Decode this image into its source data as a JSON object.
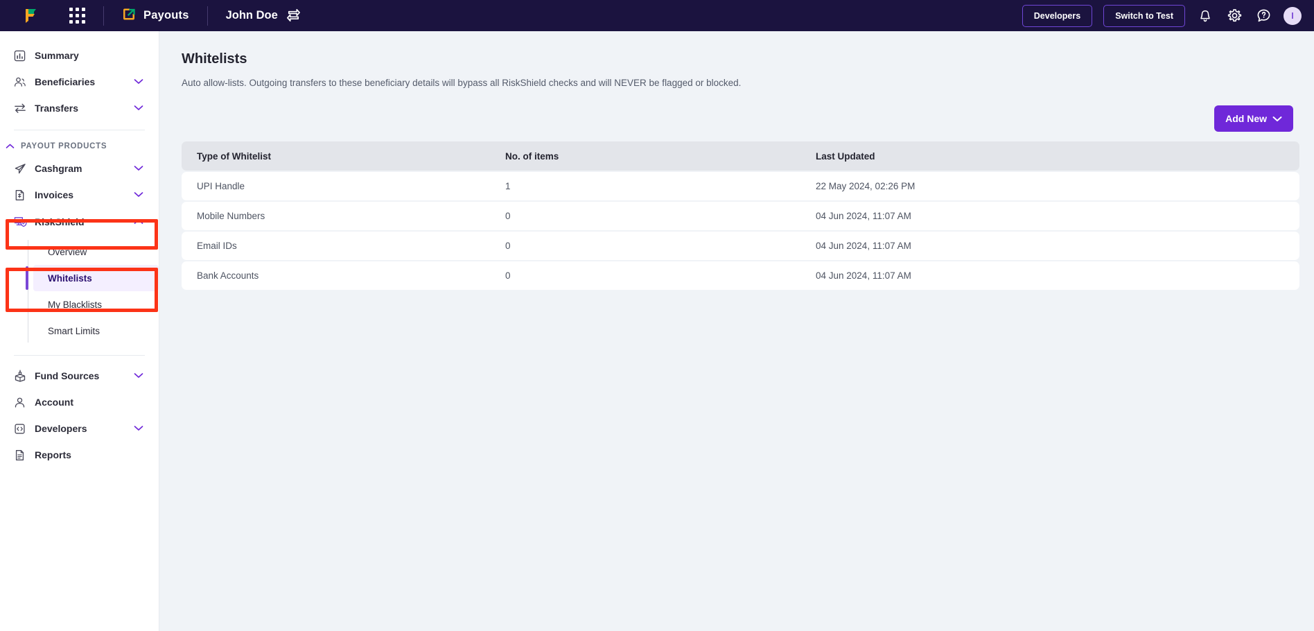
{
  "topbar": {
    "logo_icon": "cashfree-logo-icon",
    "grid_icon": "apps-grid-icon",
    "product_icon": "payouts-icon",
    "product_label": "Payouts",
    "user_name": "John Doe",
    "switch_account_icon": "switch-account-icon",
    "developers_label": "Developers",
    "switch_to_test_label": "Switch to Test",
    "bell_icon": "notification-bell-icon",
    "gear_icon": "settings-gear-icon",
    "help_icon": "help-question-icon",
    "avatar_initial": "I",
    "accent": "#6f28d9",
    "bar_bg": "#1b133f"
  },
  "sidebar": {
    "items": [
      {
        "label": "Summary",
        "icon": "chart-bar-icon",
        "chevron": false
      },
      {
        "label": "Beneficiaries",
        "icon": "people-icon",
        "chevron": true
      },
      {
        "label": "Transfers",
        "icon": "transfer-arrows-icon",
        "chevron": true
      }
    ],
    "section": {
      "title": "PAYOUT PRODUCTS",
      "caret_icon": "chevron-up-icon"
    },
    "products": [
      {
        "label": "Cashgram",
        "icon": "paper-plane-icon",
        "chevron": true
      },
      {
        "label": "Invoices",
        "icon": "invoice-doc-icon",
        "chevron": true
      },
      {
        "label": "RiskShield",
        "icon": "riskshield-shield-icon",
        "chevron": true,
        "expanded": true
      }
    ],
    "riskshield_children": [
      {
        "label": "Overview",
        "active": false
      },
      {
        "label": "Whitelists",
        "active": true
      },
      {
        "label": "My Blacklists",
        "active": false
      },
      {
        "label": "Smart Limits",
        "active": false
      }
    ],
    "bottom_items": [
      {
        "label": "Fund Sources",
        "icon": "fund-source-icon",
        "chevron": true
      },
      {
        "label": "Account",
        "icon": "person-icon",
        "chevron": false
      },
      {
        "label": "Developers",
        "icon": "code-brackets-icon",
        "chevron": true
      },
      {
        "label": "Reports",
        "icon": "report-doc-icon",
        "chevron": false
      }
    ],
    "highlight_color": "#fc3317"
  },
  "main": {
    "title": "Whitelists",
    "description": "Auto allow-lists. Outgoing transfers to these beneficiary details will bypass all RiskShield checks and will NEVER be flagged or blocked.",
    "add_new_label": "Add New",
    "add_new_chevron_icon": "chevron-down-icon",
    "table": {
      "columns": [
        "Type of Whitelist",
        "No. of items",
        "Last Updated"
      ],
      "rows": [
        {
          "type": "UPI Handle",
          "count": "1",
          "updated": "22 May 2024, 02:26 PM"
        },
        {
          "type": "Mobile Numbers",
          "count": "0",
          "updated": "04 Jun 2024, 11:07 AM"
        },
        {
          "type": "Email IDs",
          "count": "0",
          "updated": "04 Jun 2024, 11:07 AM"
        },
        {
          "type": "Bank Accounts",
          "count": "0",
          "updated": "04 Jun 2024, 11:07 AM"
        }
      ]
    }
  }
}
